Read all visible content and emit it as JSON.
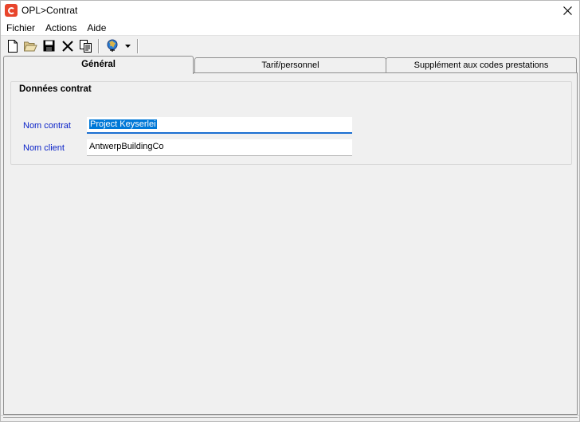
{
  "window": {
    "title": "OPL>Contrat"
  },
  "menu": {
    "items": [
      "Fichier",
      "Actions",
      "Aide"
    ]
  },
  "toolbar": {
    "icons": [
      "new-document-icon",
      "open-folder-icon",
      "save-disk-icon",
      "delete-x-icon",
      "copy-icon",
      "globe-icon"
    ]
  },
  "tabs": [
    {
      "label": "Général",
      "active": true
    },
    {
      "label": "Tarif/personnel",
      "active": false
    },
    {
      "label": "Supplément aux codes prestations",
      "active": false
    }
  ],
  "group": {
    "title": "Données contrat"
  },
  "fields": {
    "contract_name": {
      "label": "Nom contrat",
      "value": "Project Keyserlei"
    },
    "client_name": {
      "label": "Nom client",
      "value": "AntwerpBuildingCo"
    }
  },
  "colors": {
    "accent": "#0078d7",
    "label_blue": "#0a22c8",
    "logo_red": "#e8452c"
  }
}
